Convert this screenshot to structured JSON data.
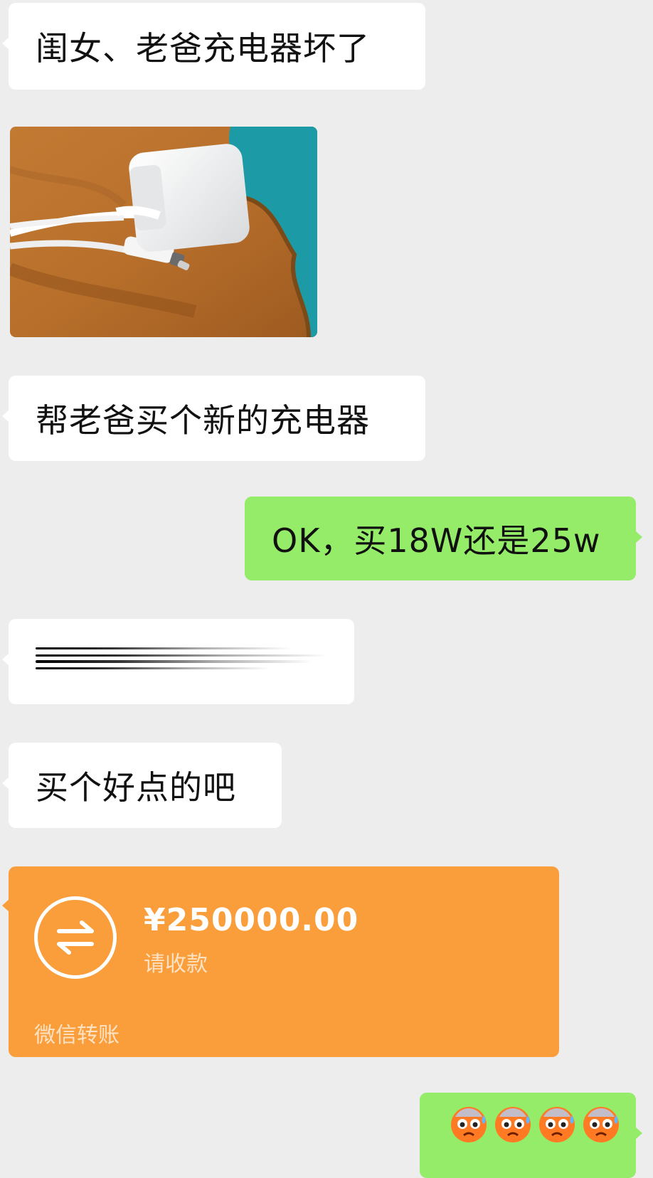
{
  "messages": {
    "m1": "闺女、老爸充电器坏了",
    "m3": "帮老爸买个新的充电器",
    "m4": "OK，买18W还是25w",
    "m6": "买个好点的吧"
  },
  "transfer": {
    "amount": "¥250000.00",
    "subtitle": "请收款",
    "footer": "微信转账"
  },
  "colors": {
    "incoming": "#ffffff",
    "outgoing": "#95ec69",
    "transfer": "#fa9d3b",
    "background": "#ededed"
  },
  "icons": [
    "transfer-icon",
    "sweating-face-emoji"
  ]
}
